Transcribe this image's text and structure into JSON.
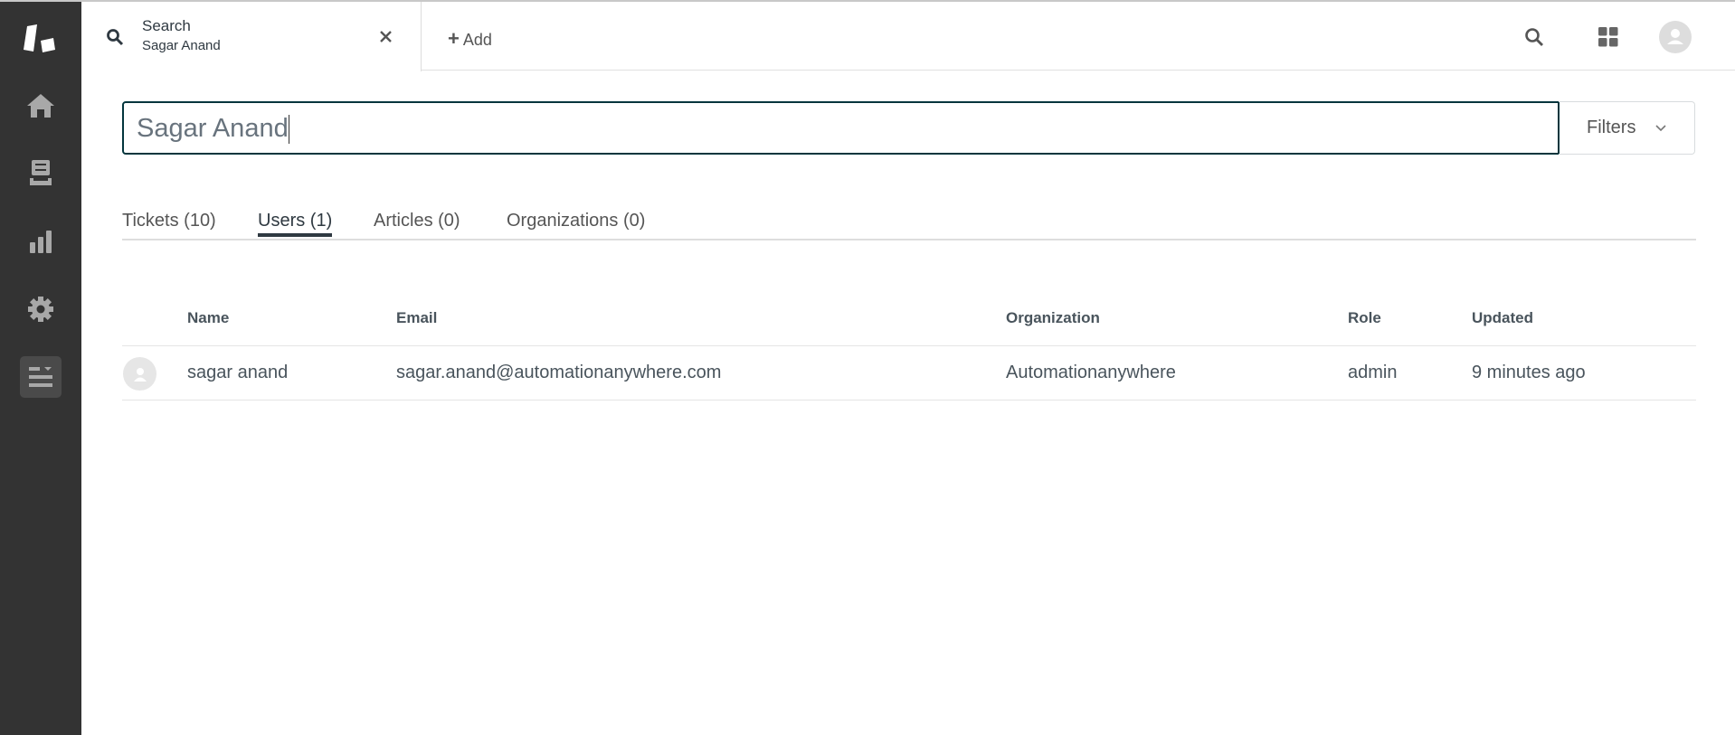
{
  "header": {
    "tab_title": "Search",
    "tab_subtitle": "Sagar Anand",
    "add_label": "Add"
  },
  "search": {
    "value": "Sagar Anand",
    "filters_label": "Filters"
  },
  "result_tabs": [
    {
      "label": "Tickets (10)"
    },
    {
      "label": "Users (1)",
      "active": true
    },
    {
      "label": "Articles (0)"
    },
    {
      "label": "Organizations (0)"
    }
  ],
  "table": {
    "columns": [
      "Name",
      "Email",
      "Organization",
      "Role",
      "Updated"
    ],
    "rows": [
      {
        "name": "sagar anand",
        "email": "sagar.anand@automationanywhere.com",
        "organization": "Automationanywhere",
        "role": "admin",
        "updated": "9 minutes ago"
      }
    ]
  }
}
